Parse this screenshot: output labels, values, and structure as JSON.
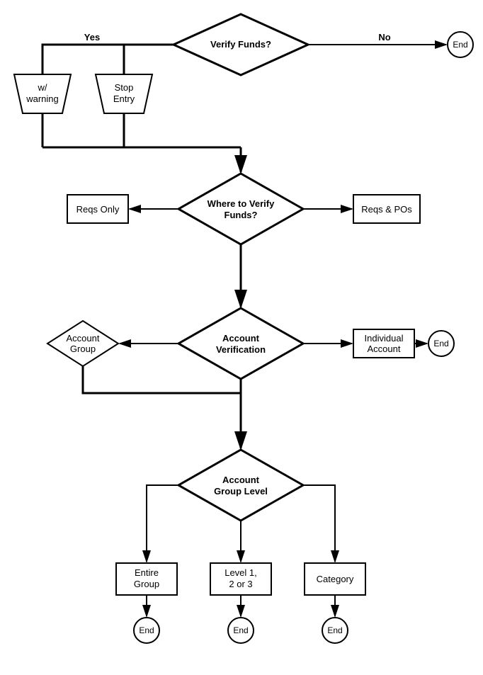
{
  "d1": "Verify Funds?",
  "d2a": "Where to Verify",
  "d2b": "Funds?",
  "d3a": "Account",
  "d3b": "Verification",
  "d4a": "Account",
  "d4b": "Group Level",
  "yesLabel": "Yes",
  "noLabel": "No",
  "endLabel": "End",
  "trapWarn1": "w/",
  "trapWarn2": "warning",
  "trapStop1": "Stop",
  "trapStop2": "Entry",
  "reqsOnly": "Reqs Only",
  "reqsPos": "Reqs & POs",
  "acctGroup1": "Account",
  "acctGroup2": "Group",
  "indiv1": "Individual",
  "indiv2": "Account",
  "entire1": "Entire",
  "entire2": "Group",
  "level1": "Level 1,",
  "level2": "2 or 3",
  "category": "Category"
}
